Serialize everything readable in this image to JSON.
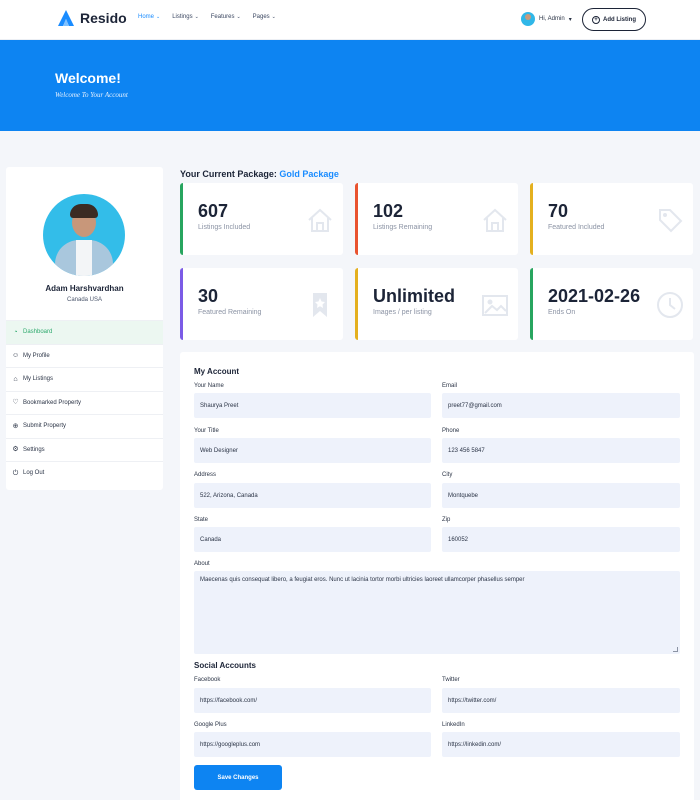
{
  "header": {
    "brand": "Resido",
    "nav": [
      {
        "label": "Home"
      },
      {
        "label": "Listings"
      },
      {
        "label": "Features"
      },
      {
        "label": "Pages"
      }
    ],
    "user_greeting": "Hi, Admin",
    "add_listing": "Add Listing"
  },
  "banner": {
    "title": "Welcome!",
    "subtitle": "Welcome To Your Account"
  },
  "profile": {
    "name": "Adam Harshvardhan",
    "location": "Canada USA"
  },
  "menu": [
    {
      "label": "Dashboard",
      "icon": "dashboard-icon"
    },
    {
      "label": "My Profile",
      "icon": "user-icon"
    },
    {
      "label": "My Listings",
      "icon": "listings-icon"
    },
    {
      "label": "Bookmarked Property",
      "icon": "heart-icon"
    },
    {
      "label": "Submit Property",
      "icon": "plus-circle-icon"
    },
    {
      "label": "Settings",
      "icon": "gear-icon"
    },
    {
      "label": "Log Out",
      "icon": "logout-icon"
    }
  ],
  "package": {
    "prefix": "Your Current Package: ",
    "name": "Gold Package"
  },
  "stats": [
    {
      "value": "607",
      "label": "Listings Included",
      "color": "#28a55f",
      "icon": "house-icon"
    },
    {
      "value": "102",
      "label": "Listings Remaining",
      "color": "#e9532f",
      "icon": "house-icon"
    },
    {
      "value": "70",
      "label": "Featured Included",
      "color": "#e4b01f",
      "icon": "tag-icon"
    },
    {
      "value": "30",
      "label": "Featured Remaining",
      "color": "#7b5be6",
      "icon": "bookmark-icon"
    },
    {
      "value": "Unlimited",
      "label": "Images / per listing",
      "color": "#e4b01f",
      "icon": "image-icon"
    },
    {
      "value": "2021-02-26",
      "label": "Ends On",
      "color": "#28a55f",
      "icon": "clock-icon"
    }
  ],
  "account": {
    "title": "My Account",
    "fields": {
      "name": {
        "label": "Your Name",
        "value": "Shaurya Preet"
      },
      "email": {
        "label": "Email",
        "value": "preet77@gmail.com"
      },
      "title": {
        "label": "Your Title",
        "value": "Web Designer"
      },
      "phone": {
        "label": "Phone",
        "value": "123 456 5847"
      },
      "address": {
        "label": "Address",
        "value": "522, Arizona, Canada"
      },
      "city": {
        "label": "City",
        "value": "Montquebe"
      },
      "state": {
        "label": "State",
        "value": "Canada"
      },
      "zip": {
        "label": "Zip",
        "value": "160052"
      },
      "about": {
        "label": "About",
        "value": "Maecenas quis consequat libero, a feugiat eros. Nunc ut lacinia tortor morbi ultricies laoreet ullamcorper phasellus semper"
      }
    }
  },
  "social": {
    "title": "Social Accounts",
    "fields": {
      "facebook": {
        "label": "Facebook",
        "value": "https://facebook.com/"
      },
      "twitter": {
        "label": "Twitter",
        "value": "https://twitter.com/"
      },
      "googleplus": {
        "label": "Google Plus",
        "value": "https://googleplus.com"
      },
      "linkedin": {
        "label": "LinkedIn",
        "value": "https://linkedin.com/"
      }
    }
  },
  "save_label": "Save Changes"
}
